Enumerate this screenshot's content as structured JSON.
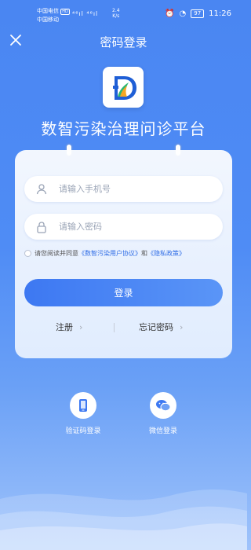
{
  "status_bar": {
    "carrier_1": "中国电信",
    "carrier_1_tag": "HD",
    "carrier_2": "中国移动",
    "signal": "⁴⁶ıl ⁴⁶ıl",
    "speed_value": "2.4",
    "speed_unit": "K/s",
    "battery": "97",
    "time": "11:26"
  },
  "header": {
    "title": "密码登录"
  },
  "app": {
    "name": "数智污染治理问诊平台"
  },
  "form": {
    "phone_placeholder": "请输入手机号",
    "password_placeholder": "请输入密码",
    "agreement_prefix": "请您阅读并同意",
    "user_agreement": "《数智污染用户协议》",
    "agreement_and": "和",
    "privacy_policy": "《隐私政策》",
    "login_label": "登录",
    "register_label": "注册",
    "forgot_label": "忘记密码"
  },
  "alt_login": [
    {
      "label": "验证码登录",
      "icon": "phone-icon"
    },
    {
      "label": "微信登录",
      "icon": "wechat-icon"
    }
  ],
  "colors": {
    "primary": "#4a86f2",
    "link": "#2f6de6",
    "button": "#3d78f2"
  }
}
